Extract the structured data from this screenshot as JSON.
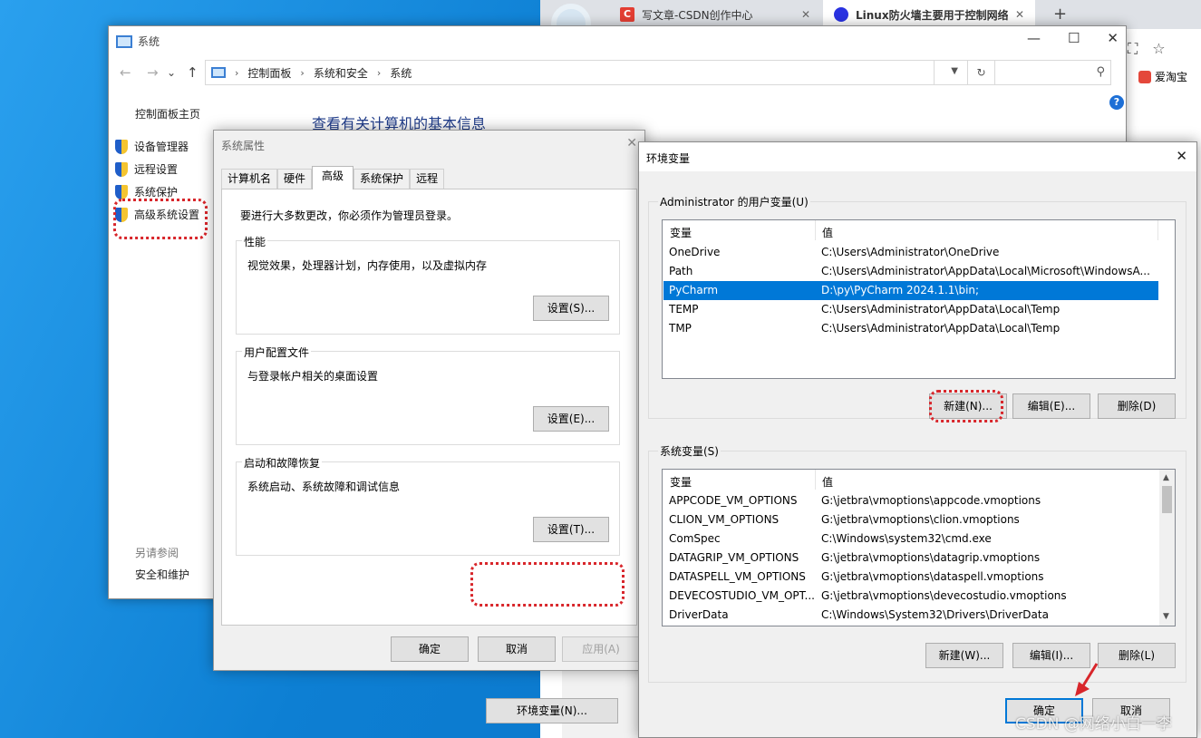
{
  "browser": {
    "tabs": [
      {
        "label": "写文章-CSDN创作中心",
        "icon": "csdn-icon"
      },
      {
        "label": "Linux防火墙主要用于控制网络流",
        "icon": "baidu-paw-icon"
      }
    ],
    "bookmark": "爱淘宝"
  },
  "system_window": {
    "title": "系统",
    "breadcrumb": [
      "控制面板",
      "系统和安全",
      "系统"
    ],
    "sidebar": {
      "home": "控制面板主页",
      "items": [
        {
          "label": "设备管理器",
          "icon": "shield-icon"
        },
        {
          "label": "远程设置",
          "icon": "shield-icon"
        },
        {
          "label": "系统保护",
          "icon": "shield-icon"
        },
        {
          "label": "高级系统设置",
          "icon": "shield-icon"
        }
      ],
      "see_also": "另请参阅",
      "security": "安全和维护"
    },
    "heading": "查看有关计算机的基本信息"
  },
  "system_properties": {
    "title": "系统属性",
    "tabs": [
      "计算机名",
      "硬件",
      "高级",
      "系统保护",
      "远程"
    ],
    "active_tab": "高级",
    "admin_note": "要进行大多数更改，你必须作为管理员登录。",
    "groups": [
      {
        "title": "性能",
        "desc": "视觉效果，处理器计划，内存使用，以及虚拟内存",
        "button": "设置(S)..."
      },
      {
        "title": "用户配置文件",
        "desc": "与登录帐户相关的桌面设置",
        "button": "设置(E)..."
      },
      {
        "title": "启动和故障恢复",
        "desc": "系统启动、系统故障和调试信息",
        "button": "设置(T)..."
      }
    ],
    "env_button": "环境变量(N)...",
    "ok": "确定",
    "cancel": "取消",
    "apply": "应用(A)"
  },
  "env_vars": {
    "title": "环境变量",
    "user_group_title": "Administrator 的用户变量(U)",
    "col_var": "变量",
    "col_val": "值",
    "user_vars": [
      {
        "name": "OneDrive",
        "value": "C:\\Users\\Administrator\\OneDrive"
      },
      {
        "name": "Path",
        "value": "C:\\Users\\Administrator\\AppData\\Local\\Microsoft\\WindowsA..."
      },
      {
        "name": "PyCharm",
        "value": "D:\\py\\PyCharm 2024.1.1\\bin;"
      },
      {
        "name": "TEMP",
        "value": "C:\\Users\\Administrator\\AppData\\Local\\Temp"
      },
      {
        "name": "TMP",
        "value": "C:\\Users\\Administrator\\AppData\\Local\\Temp"
      }
    ],
    "selected_user_var": "PyCharm",
    "user_buttons": {
      "new": "新建(N)...",
      "edit": "编辑(E)...",
      "delete": "删除(D)"
    },
    "sys_group_title": "系统变量(S)",
    "sys_vars": [
      {
        "name": "APPCODE_VM_OPTIONS",
        "value": "G:\\jetbra\\vmoptions\\appcode.vmoptions"
      },
      {
        "name": "CLION_VM_OPTIONS",
        "value": "G:\\jetbra\\vmoptions\\clion.vmoptions"
      },
      {
        "name": "ComSpec",
        "value": "C:\\Windows\\system32\\cmd.exe"
      },
      {
        "name": "DATAGRIP_VM_OPTIONS",
        "value": "G:\\jetbra\\vmoptions\\datagrip.vmoptions"
      },
      {
        "name": "DATASPELL_VM_OPTIONS",
        "value": "G:\\jetbra\\vmoptions\\dataspell.vmoptions"
      },
      {
        "name": "DEVECOSTUDIO_VM_OPT...",
        "value": "G:\\jetbra\\vmoptions\\devecostudio.vmoptions"
      },
      {
        "name": "DriverData",
        "value": "C:\\Windows\\System32\\Drivers\\DriverData"
      }
    ],
    "sys_buttons": {
      "new": "新建(W)...",
      "edit": "编辑(I)...",
      "delete": "删除(L)"
    },
    "ok": "确定",
    "cancel": "取消"
  },
  "watermark": "CSDN @网络小白一李",
  "colors": {
    "highlight": "#d8262b",
    "selection": "#0078d7"
  }
}
